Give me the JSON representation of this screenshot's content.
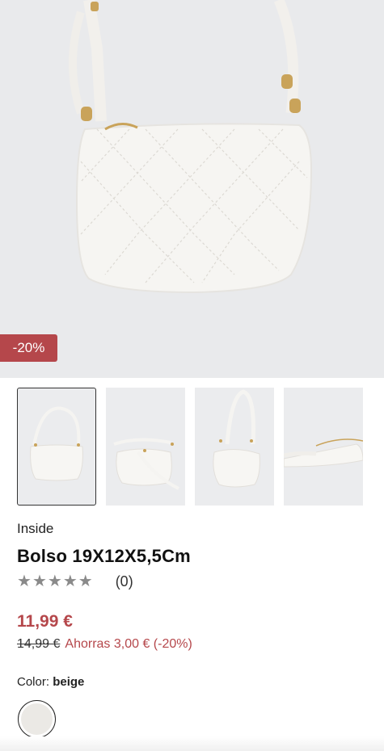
{
  "product": {
    "discount_badge": "-20%",
    "brand": "Inside",
    "title": "Bolso 19X12X5,5Cm",
    "rating_stars": 5,
    "review_count": "(0)",
    "price": "11,99 €",
    "old_price": "14,99 €",
    "savings": "Ahorras 3,00 € (-20%)",
    "color_label": "Color:",
    "color_value": "beige"
  },
  "gallery": {
    "thumbnails": [
      "front-view",
      "side-view-strap",
      "angled-view",
      "close-up-detail"
    ],
    "selected_index": 0
  },
  "colors": {
    "accent": "#b5474b",
    "swatch": "#ebe9e5"
  }
}
